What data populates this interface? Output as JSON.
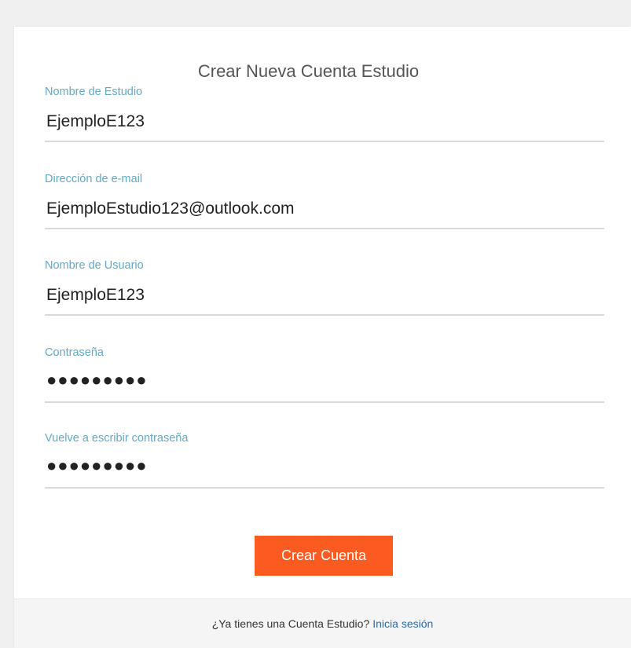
{
  "form": {
    "title": "Crear Nueva Cuenta Estudio",
    "fields": [
      {
        "label": "Nombre de Estudio",
        "value": "EjemploE123"
      },
      {
        "label": "Dirección de e-mail",
        "value": "EjemploEstudio123@outlook.com"
      },
      {
        "label": "Nombre de Usuario",
        "value": "EjemploE123"
      },
      {
        "label": "Contraseña",
        "value": "●●●●●●●●●"
      },
      {
        "label": "Vuelve a escribir contraseña",
        "value": "●●●●●●●●●"
      }
    ],
    "submit_label": "Crear Cuenta"
  },
  "footer": {
    "prompt": "¿Ya tienes una Cuenta Estudio?",
    "link_label": "Inicia sesión"
  },
  "colors": {
    "accent": "#fb5a20",
    "label": "#62a9c7",
    "link": "#2e6aa8"
  }
}
